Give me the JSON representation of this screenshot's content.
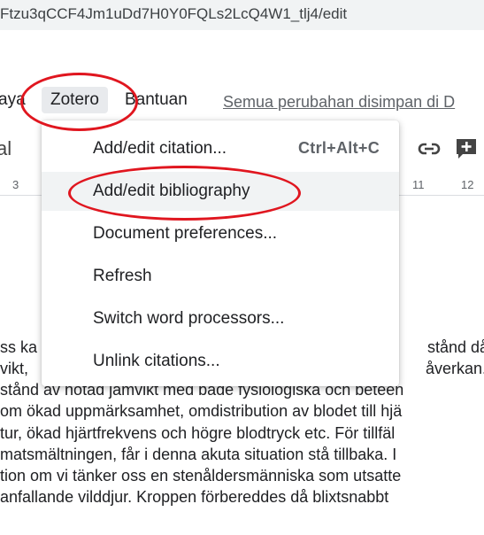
{
  "url": "Ftzu3qCCF4Jm1uDd7H0Y0FQLs2LcQ4W1_tlj4/edit",
  "menubar": {
    "item_left_partial": "aya",
    "zotero": "Zotero",
    "bantuan": "Bantuan",
    "saved_status": "Semua perubahan disimpan di D"
  },
  "toolbar": {
    "left_fragment": "al"
  },
  "ruler": {
    "left_num": "3",
    "right_nums": [
      "11",
      "12"
    ]
  },
  "zotero_menu": {
    "items": [
      {
        "label": "Add/edit citation...",
        "shortcut": "Ctrl+Alt+C"
      },
      {
        "label": "Add/edit bibliography"
      },
      {
        "label": "Document preferences..."
      },
      {
        "label": "Refresh"
      },
      {
        "label": "Switch word processors..."
      },
      {
        "label": "Unlink citations..."
      }
    ]
  },
  "document": {
    "lines": [
      {
        "left": "ss ka",
        "right": "stånd då d"
      },
      {
        "left": "vikt, ",
        "right": "åverkan. V"
      },
      {
        "full": "stånd av hotad jämvikt med både fysiologiska och beteen"
      },
      {
        "full": "om ökad uppmärksamhet, omdistribution av blodet till hjä"
      },
      {
        "full": "tur, ökad hjärtfrekvens och högre blodtryck etc. För tillfäl"
      },
      {
        "full": "matsmältningen, får i denna akuta situation stå tillbaka. I"
      },
      {
        "full": "tion om vi tänker oss en stenåldersmänniska som utsatte"
      },
      {
        "full": "anfallande vilddjur. Kroppen förbereddes då blixtsnabbt"
      }
    ]
  },
  "colors": {
    "annotation_red": "#e0161f",
    "menu_highlight": "#f1f3f4"
  },
  "icons": [
    "link-icon",
    "add-comment-icon"
  ]
}
